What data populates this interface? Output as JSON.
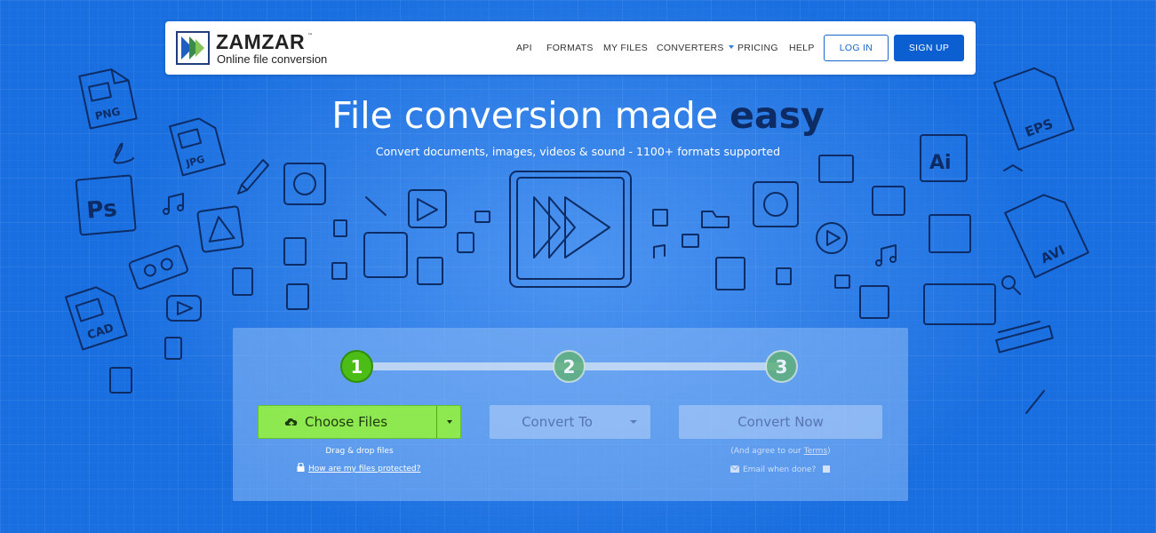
{
  "brand": {
    "name": "ZAMZAR",
    "tm": "™",
    "tagline": "Online file conversion"
  },
  "nav": {
    "items": [
      {
        "label": "API"
      },
      {
        "label": "FORMATS"
      },
      {
        "label": "MY FILES"
      },
      {
        "label": "CONVERTERS"
      },
      {
        "label": "PRICING"
      },
      {
        "label": "HELP"
      }
    ],
    "login_label": "LOG IN",
    "signup_label": "SIGN UP"
  },
  "hero": {
    "title_main": "File conversion made ",
    "title_emphasis": "easy",
    "subtitle": "Convert documents, images, videos & sound - 1100+ formats supported"
  },
  "converter": {
    "steps": [
      "1",
      "2",
      "3"
    ],
    "current_step": 1,
    "choose_files_label": "Choose Files",
    "drag_drop_text": "Drag & drop files",
    "protect_link": "How are my files protected?",
    "convert_to_label": "Convert To",
    "convert_now_label": "Convert Now",
    "agree_prefix": "(And agree to our ",
    "agree_link": "Terms",
    "agree_suffix": ")",
    "email_label": "Email when done?"
  },
  "doodle_labels": {
    "png": "PNG",
    "jpg": "JPG",
    "ps": "Ps",
    "cad": "CAD",
    "eps": "EPS",
    "ai": "Ai",
    "avi": "AVI"
  },
  "colors": {
    "background": "#1a6fe0",
    "accent_blue": "#0b5fd1",
    "choose_green": "#8ee84f",
    "step_active": "#4bbd16",
    "doodle_ink": "#0d2c66"
  }
}
